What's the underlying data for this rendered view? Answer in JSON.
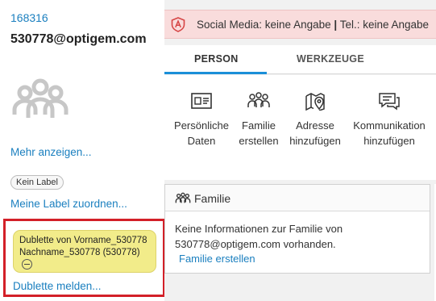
{
  "contact": {
    "id": "168316",
    "email_title": "530778@optigem.com",
    "avatar_icon": "people-group-icon"
  },
  "links": {
    "more": "Mehr anzeigen...",
    "assign_label": "Meine Label zuordnen...",
    "report_duplicate": "Dublette melden..."
  },
  "label_chip": "Kein Label",
  "duplicate": {
    "line1": "Dublette von Vorname_530778",
    "line2": "Nachname_530778 (530778)",
    "remove_icon": "minus-circle-icon"
  },
  "alert": {
    "icon": "shield-warning-icon",
    "text_part1": "Social Media: keine Angabe",
    "separator": "|",
    "text_part2": "Tel.: keine Angabe"
  },
  "tabs": [
    {
      "label": "PERSON",
      "active": true
    },
    {
      "label": "WERKZEUGE",
      "active": false
    }
  ],
  "ribbon": [
    {
      "line1": "Persönliche",
      "line2": "Daten",
      "icon": "id-card-icon"
    },
    {
      "line1": "Familie",
      "line2": "erstellen",
      "icon": "family-icon"
    },
    {
      "line1": "Adresse",
      "line2": "hinzufügen",
      "icon": "map-pin-icon"
    },
    {
      "line1": "Kommunikation",
      "line2": "hinzufügen",
      "icon": "chat-bubbles-icon"
    }
  ],
  "family": {
    "title": "Familie",
    "info_line1": "Keine Informationen zur Familie von",
    "info_line2": "530778@optigem.com vorhanden.",
    "create_link": "Familie erstellen"
  },
  "colors": {
    "link": "#1a7fbf",
    "accent_tab": "#1a8fd8",
    "alert_bg": "#f9dcdc",
    "duplicate_bg": "#f2ec8a",
    "highlight_frame": "#d32028"
  }
}
